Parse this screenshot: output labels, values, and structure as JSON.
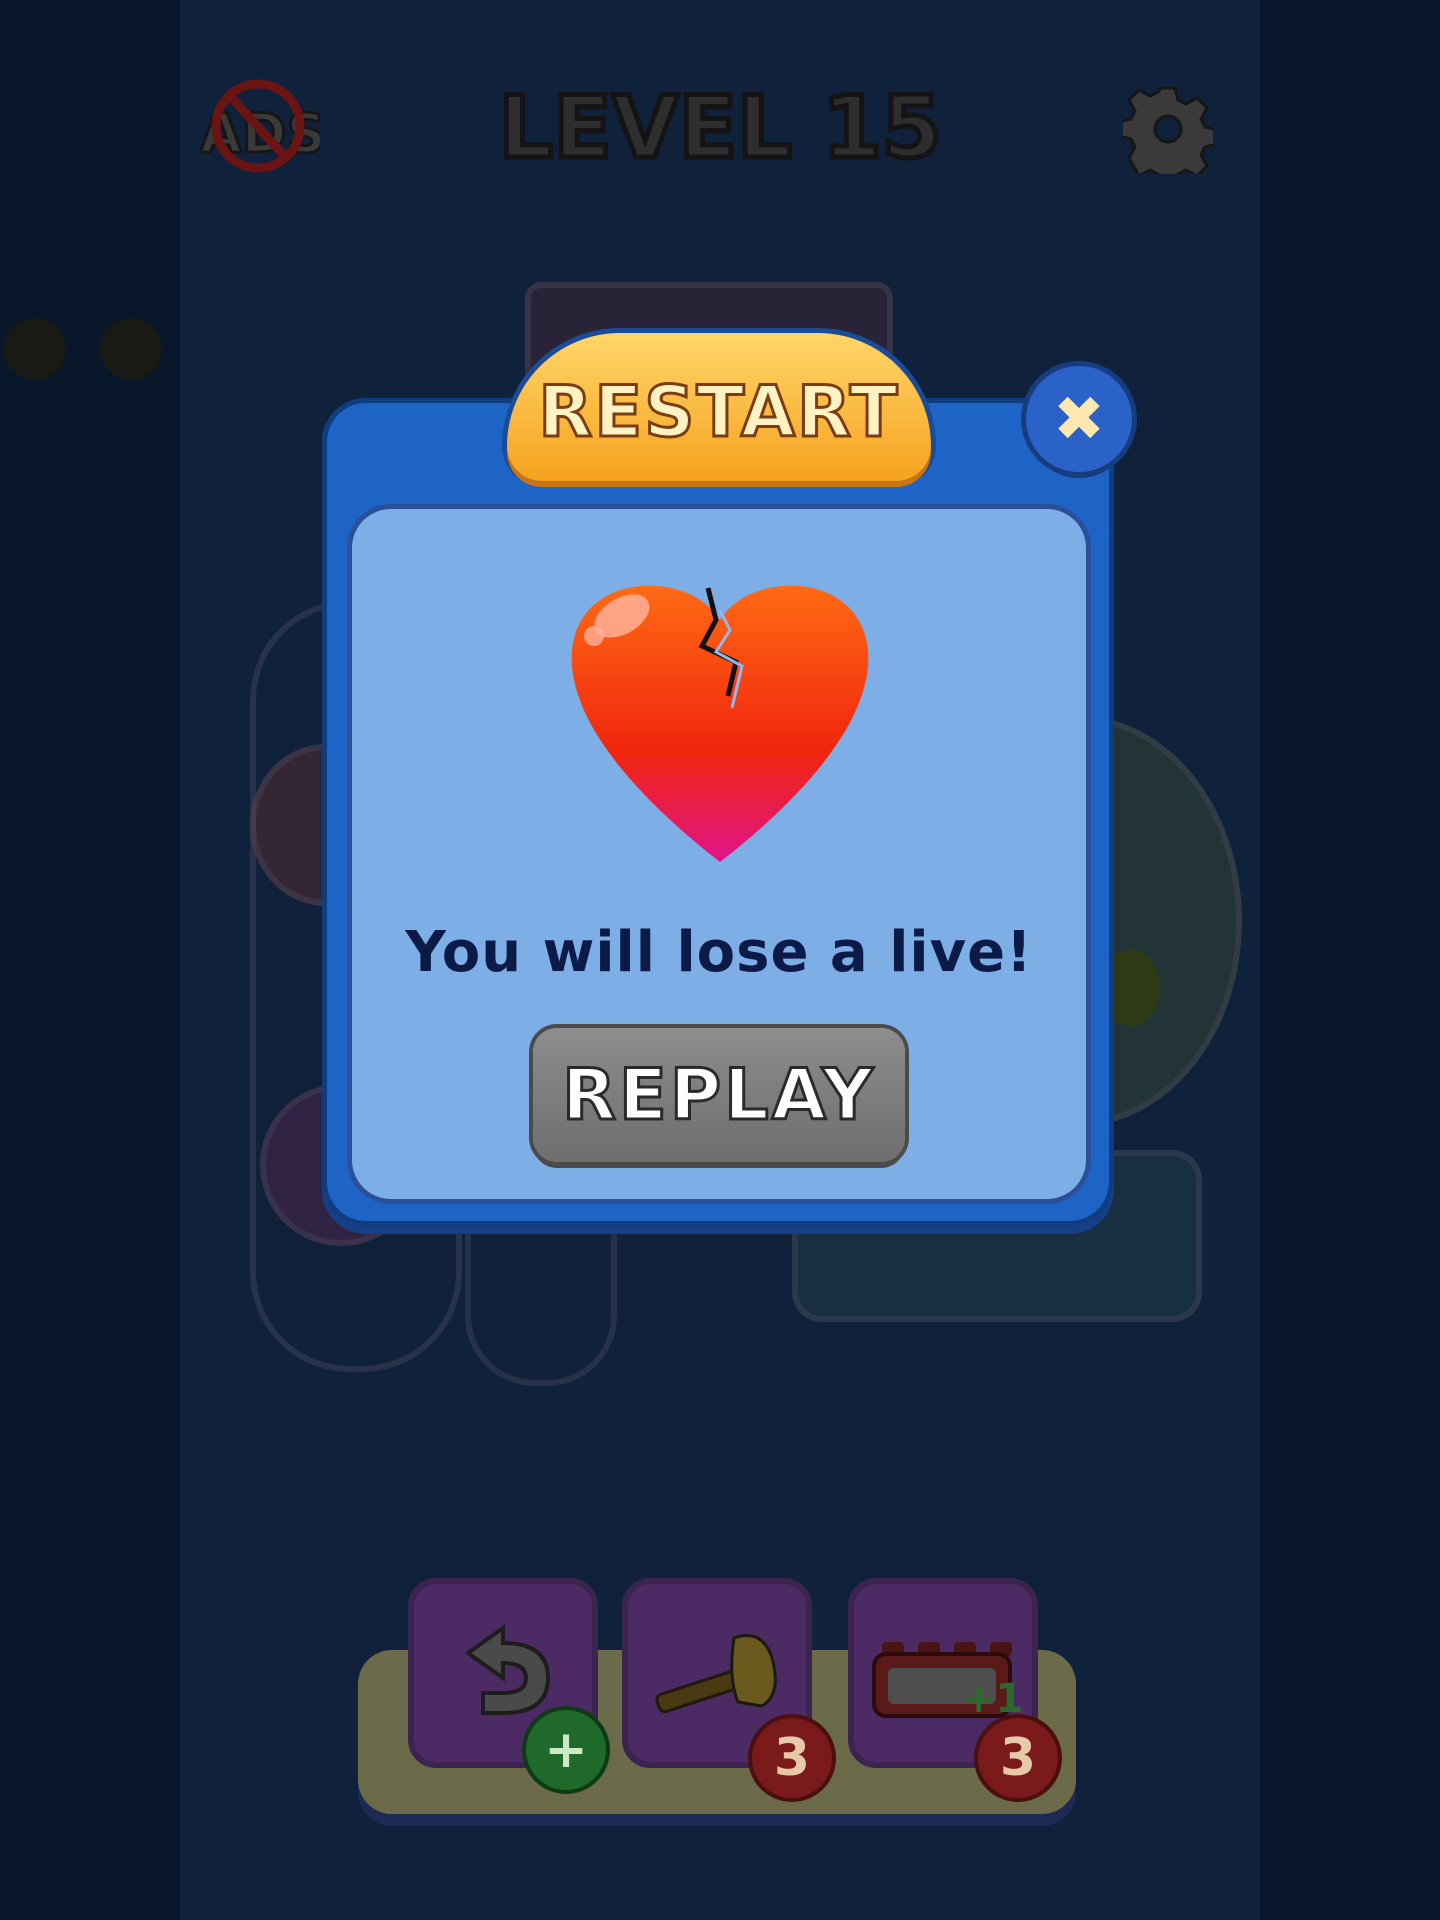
{
  "header": {
    "title": "LEVEL 15",
    "no_ads_label": "ADS"
  },
  "modal": {
    "title": "RESTART",
    "message": "You will lose a live!",
    "replay_label": "REPLAY",
    "close_symbol": "✖"
  },
  "tools": [
    {
      "name": "undo",
      "badge": "+",
      "badge_color": "green"
    },
    {
      "name": "hammer",
      "badge": "3",
      "badge_color": "red"
    },
    {
      "name": "extra-slot",
      "overlay": "+1",
      "badge": "3",
      "badge_color": "red"
    }
  ],
  "colors": {
    "modal_blue": "#1e63c6",
    "panel_light": "#7daee6",
    "tab_gold": "#f5a21e",
    "replay_gray": "#7a7a7a",
    "heart_red": "#f02a10"
  }
}
